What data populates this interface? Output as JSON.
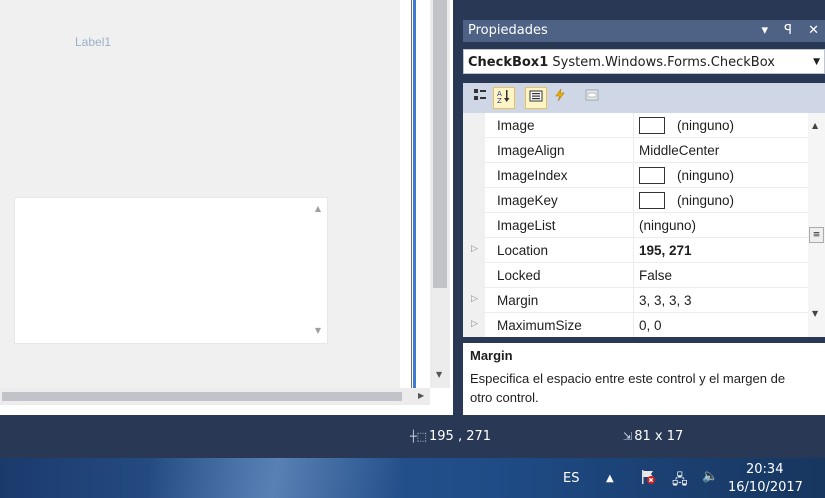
{
  "designer": {
    "label_text": "Label1"
  },
  "properties": {
    "title": "Propiedades",
    "title_controls": "▾ ᵖ ✕",
    "object_name": "CheckBox1",
    "object_type": "System.Windows.Forms.CheckBox",
    "rows": [
      {
        "name": "Image",
        "value": "(ninguno)",
        "swatch": true,
        "expandable": false,
        "bold": false
      },
      {
        "name": "ImageAlign",
        "value": "MiddleCenter",
        "swatch": false,
        "expandable": false,
        "bold": false
      },
      {
        "name": "ImageIndex",
        "value": "(ninguno)",
        "swatch": true,
        "expandable": false,
        "bold": false
      },
      {
        "name": "ImageKey",
        "value": "(ninguno)",
        "swatch": true,
        "expandable": false,
        "bold": false
      },
      {
        "name": "ImageList",
        "value": "(ninguno)",
        "swatch": false,
        "expandable": false,
        "bold": false
      },
      {
        "name": "Location",
        "value": "195, 271",
        "swatch": false,
        "expandable": true,
        "bold": true
      },
      {
        "name": "Locked",
        "value": "False",
        "swatch": false,
        "expandable": false,
        "bold": false
      },
      {
        "name": "Margin",
        "value": "3, 3, 3, 3",
        "swatch": false,
        "expandable": true,
        "bold": false
      },
      {
        "name": "MaximumSize",
        "value": "0, 0",
        "swatch": false,
        "expandable": true,
        "bold": false
      }
    ],
    "description_title": "Margin",
    "description_text": "Especifica el espacio entre este control y el margen de otro control."
  },
  "status_bar": {
    "location": "195 , 271",
    "size": "81 x 17"
  },
  "taskbar": {
    "language": "ES",
    "time": "20:34",
    "date": "16/10/2017"
  },
  "colors": {
    "vs_dark_blue": "#293955",
    "title_blue": "#4e6285",
    "designer_gray": "#f0f0f0",
    "selection_blue": "#3d7bd1"
  }
}
